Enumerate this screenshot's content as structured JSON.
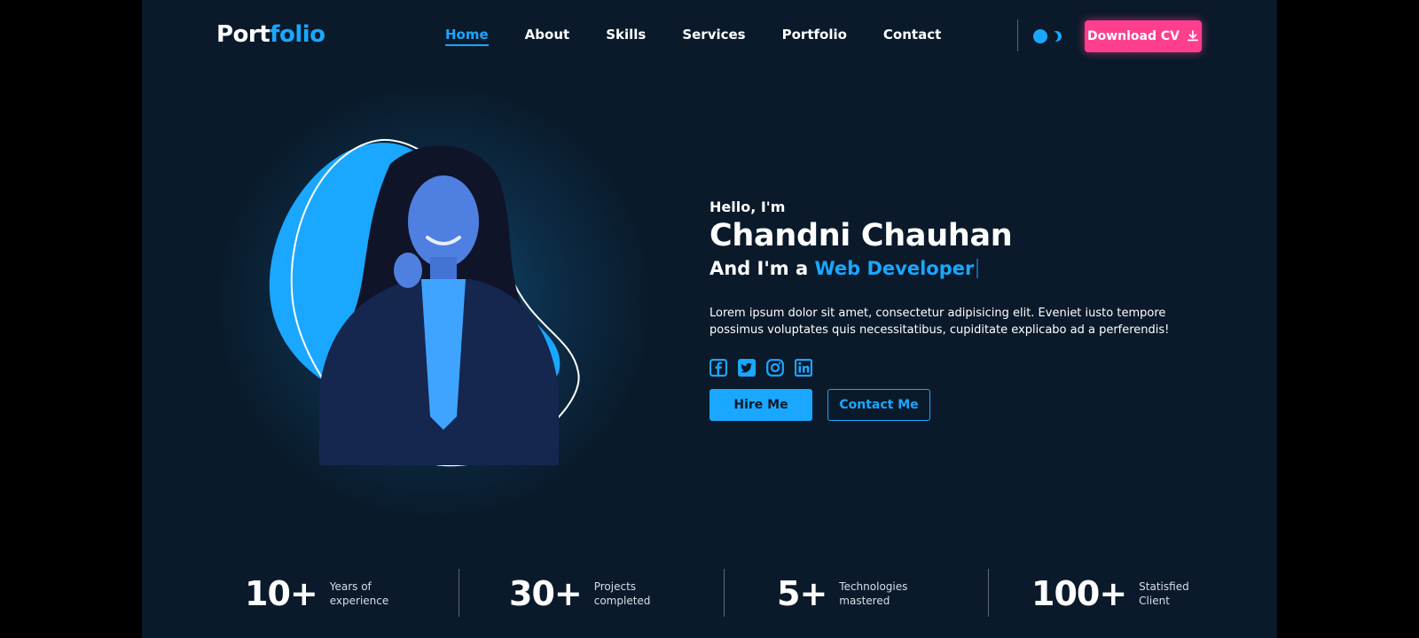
{
  "header": {
    "logo_part1": "Port",
    "logo_part2": "folio",
    "nav": [
      "Home",
      "About",
      "Skills",
      "Services",
      "Portfolio",
      "Contact"
    ],
    "active_nav": "Home",
    "download_label": "Download CV"
  },
  "hero": {
    "greeting": "Hello, I'm",
    "name": "Chandni Chauhan",
    "role_prefix": "And I'm a ",
    "role_highlight": "Web Developer",
    "description": "Lorem ipsum dolor sit amet, consectetur adipisicing elit. Eveniet iusto tempore possimus voluptates quis necessitatibus, cupiditate explicabo ad a perferendis!",
    "socials": [
      "facebook-icon",
      "twitter-icon",
      "instagram-icon",
      "linkedin-icon"
    ],
    "hire_label": "Hire Me",
    "contact_label": "Contact Me"
  },
  "stats": [
    {
      "number": "10+",
      "label": "Years of experience"
    },
    {
      "number": "30+",
      "label": "Projects completed"
    },
    {
      "number": "5+",
      "label": "Technologies mastered"
    },
    {
      "number": "100+",
      "label": "Statisfied Client"
    }
  ],
  "colors": {
    "background": "#0a1a2b",
    "accent": "#1aa7ff",
    "cta_pink": "#ff3f8e"
  }
}
